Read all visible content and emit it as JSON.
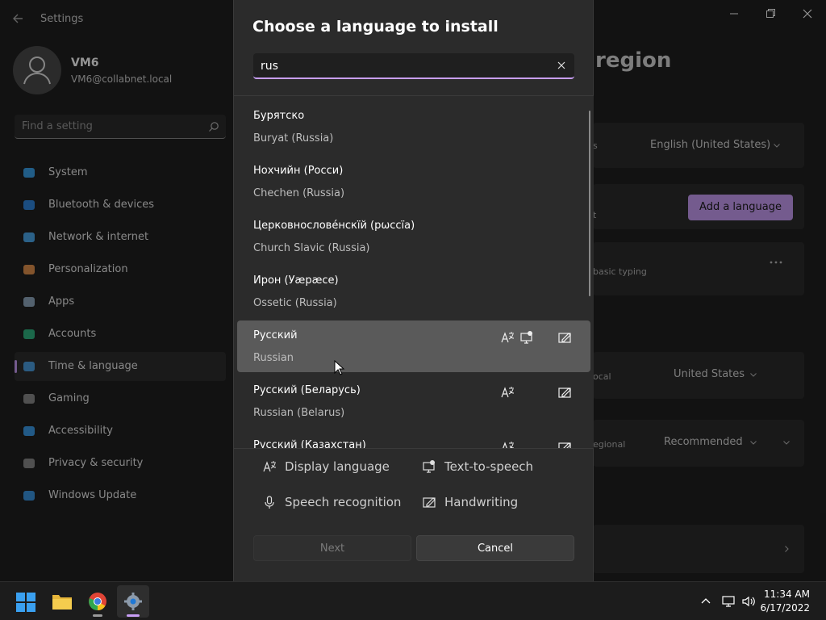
{
  "settings": {
    "window_title": "Settings",
    "profile": {
      "name": "VM6",
      "email": "VM6@collabnet.local"
    },
    "search_placeholder": "Find a setting",
    "nav": [
      {
        "label": "System",
        "icon": "monitor-icon",
        "color": "#3aa0e8"
      },
      {
        "label": "Bluetooth & devices",
        "icon": "bluetooth-icon",
        "color": "#2f86dd"
      },
      {
        "label": "Network & internet",
        "icon": "wifi-icon",
        "color": "#4aa8ea"
      },
      {
        "label": "Personalization",
        "icon": "brush-icon",
        "color": "#e2924d"
      },
      {
        "label": "Apps",
        "icon": "apps-icon",
        "color": "#8fa7bd"
      },
      {
        "label": "Accounts",
        "icon": "person-icon",
        "color": "#2fb380"
      },
      {
        "label": "Time & language",
        "icon": "globe-clock-icon",
        "color": "#4b9ede"
      },
      {
        "label": "Gaming",
        "icon": "gamepad-icon",
        "color": "#8a8a8a"
      },
      {
        "label": "Accessibility",
        "icon": "accessibility-icon",
        "color": "#3c9ce8"
      },
      {
        "label": "Privacy & security",
        "icon": "shield-icon",
        "color": "#8a8a8a"
      },
      {
        "label": "Windows Update",
        "icon": "update-icon",
        "color": "#3a95e0"
      }
    ],
    "active_nav_index": 6,
    "page_title_fragment": "region",
    "windows_display_language_value": "English (United States)",
    "add_language_label": "Add a language",
    "card_fragments": {
      "row1": "s",
      "row2": "t",
      "row3": "basic typing",
      "region_label": "ocal",
      "region_value": "United States",
      "format_label": "egional",
      "format_value": "Recommended"
    },
    "accent": "#c89ef5"
  },
  "dialog": {
    "title": "Choose a language to install",
    "search_value": "rus",
    "languages": [
      {
        "native": "Бурятско",
        "english": "Buryat (Russia)",
        "features": []
      },
      {
        "native": "Нохчийн (Росси)",
        "english": "Chechen (Russia)",
        "features": []
      },
      {
        "native": "Церковнослове́нскїй (рѡссїа)",
        "english": "Church Slavic (Russia)",
        "features": []
      },
      {
        "native": "Ирон (Уæрæсе)",
        "english": "Ossetic (Russia)",
        "features": []
      },
      {
        "native": "Русский",
        "english": "Russian",
        "features": [
          "display-language",
          "text-to-speech",
          "handwriting"
        ],
        "hover": true
      },
      {
        "native": "Русский (Беларусь)",
        "english": "Russian (Belarus)",
        "features": [
          "display-language",
          "handwriting"
        ]
      },
      {
        "native": "Русский (Казахстан)",
        "english": "",
        "features": [
          "display-language",
          "handwriting"
        ]
      }
    ],
    "legend": {
      "display_language": "Display language",
      "text_to_speech": "Text-to-speech",
      "speech_recognition": "Speech recognition",
      "handwriting": "Handwriting"
    },
    "next_label": "Next",
    "cancel_label": "Cancel"
  },
  "taskbar": {
    "apps": [
      {
        "name": "start",
        "icon": "windows-logo-icon"
      },
      {
        "name": "file-explorer",
        "icon": "folder-icon"
      },
      {
        "name": "chrome",
        "icon": "chrome-icon"
      },
      {
        "name": "settings",
        "icon": "gear-icon",
        "active": true
      }
    ],
    "time": "11:34 AM",
    "date": "6/17/2022"
  }
}
